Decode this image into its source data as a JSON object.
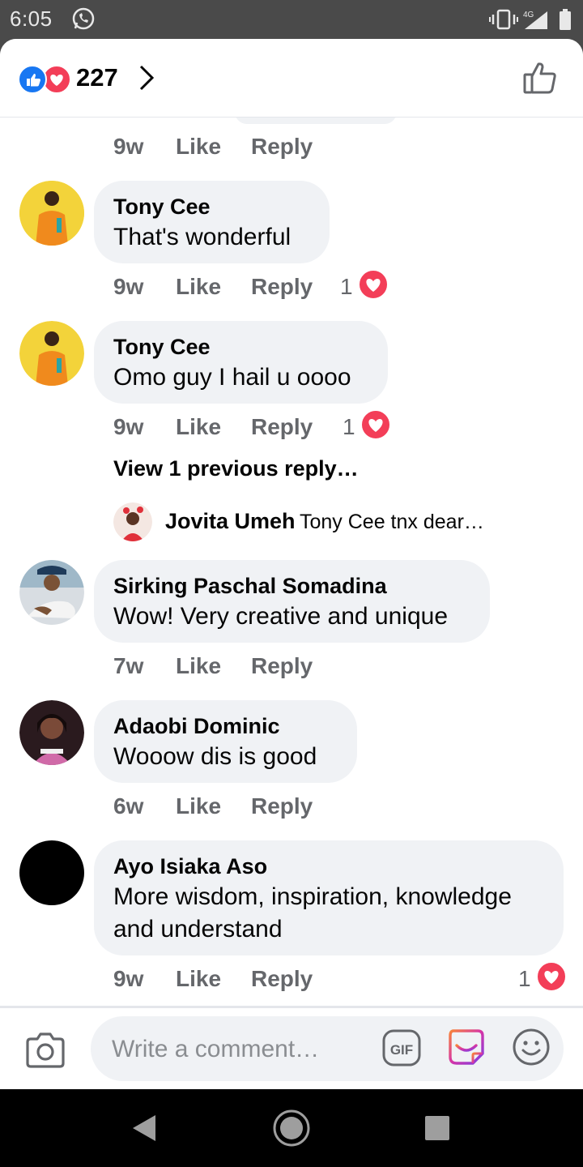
{
  "status_bar": {
    "time": "6:05",
    "network": "4G"
  },
  "header": {
    "reaction_count": "227",
    "reactions": [
      "like-icon",
      "love-icon"
    ]
  },
  "comments": [
    {
      "name": "Tony Cee",
      "text": "That's wonderful",
      "time": "9w",
      "like": "Like",
      "reply": "Reply",
      "reactions": "1"
    },
    {
      "name": "Tony Cee",
      "text": "Omo guy I hail u oooo",
      "time": "9w",
      "like": "Like",
      "reply": "Reply",
      "reactions": "1",
      "view_previous": "View 1 previous reply…",
      "latest_reply": {
        "name": "Jovita Umeh",
        "text": "Tony Cee tnx dear…"
      }
    },
    {
      "name": "Sirking Paschal Somadina",
      "text": "Wow! Very creative and unique",
      "time": "7w",
      "like": "Like",
      "reply": "Reply"
    },
    {
      "name": "Adaobi Dominic",
      "text": "Wooow dis is good",
      "time": "6w",
      "like": "Like",
      "reply": "Reply"
    },
    {
      "name": "Ayo Isiaka Aso",
      "text_line1": "More wisdom, inspiration, knowledge",
      "text_line2": "and understand",
      "time": "9w",
      "like": "Like",
      "reply": "Reply",
      "reactions": "1"
    }
  ],
  "top_stub": {
    "time": "9w",
    "like": "Like",
    "reply": "Reply"
  },
  "composer": {
    "placeholder": "Write a comment…",
    "gif_label": "GIF"
  },
  "colors": {
    "accent": "#1877f2",
    "love": "#f33e58",
    "bubble": "#f0f2f5",
    "meta": "#65676b"
  }
}
